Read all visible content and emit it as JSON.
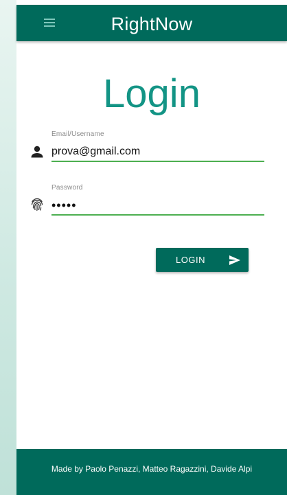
{
  "app": {
    "title": "RightNow",
    "menu_icon": "hamburger-menu-icon",
    "brand_color": "#006a5b",
    "accent_color": "#139485"
  },
  "login": {
    "heading": "Login",
    "email": {
      "label": "Email/Username",
      "value": "prova@gmail.com",
      "icon": "person-icon"
    },
    "password": {
      "label": "Password",
      "value": "•••••",
      "icon": "fingerprint-icon"
    },
    "submit": {
      "label": "LOGIN",
      "icon": "send-icon"
    },
    "input_underline_color": "#4caf50"
  },
  "footer": {
    "credits": "Made by Paolo Penazzi, Matteo Ragazzini, Davide Alpi"
  }
}
